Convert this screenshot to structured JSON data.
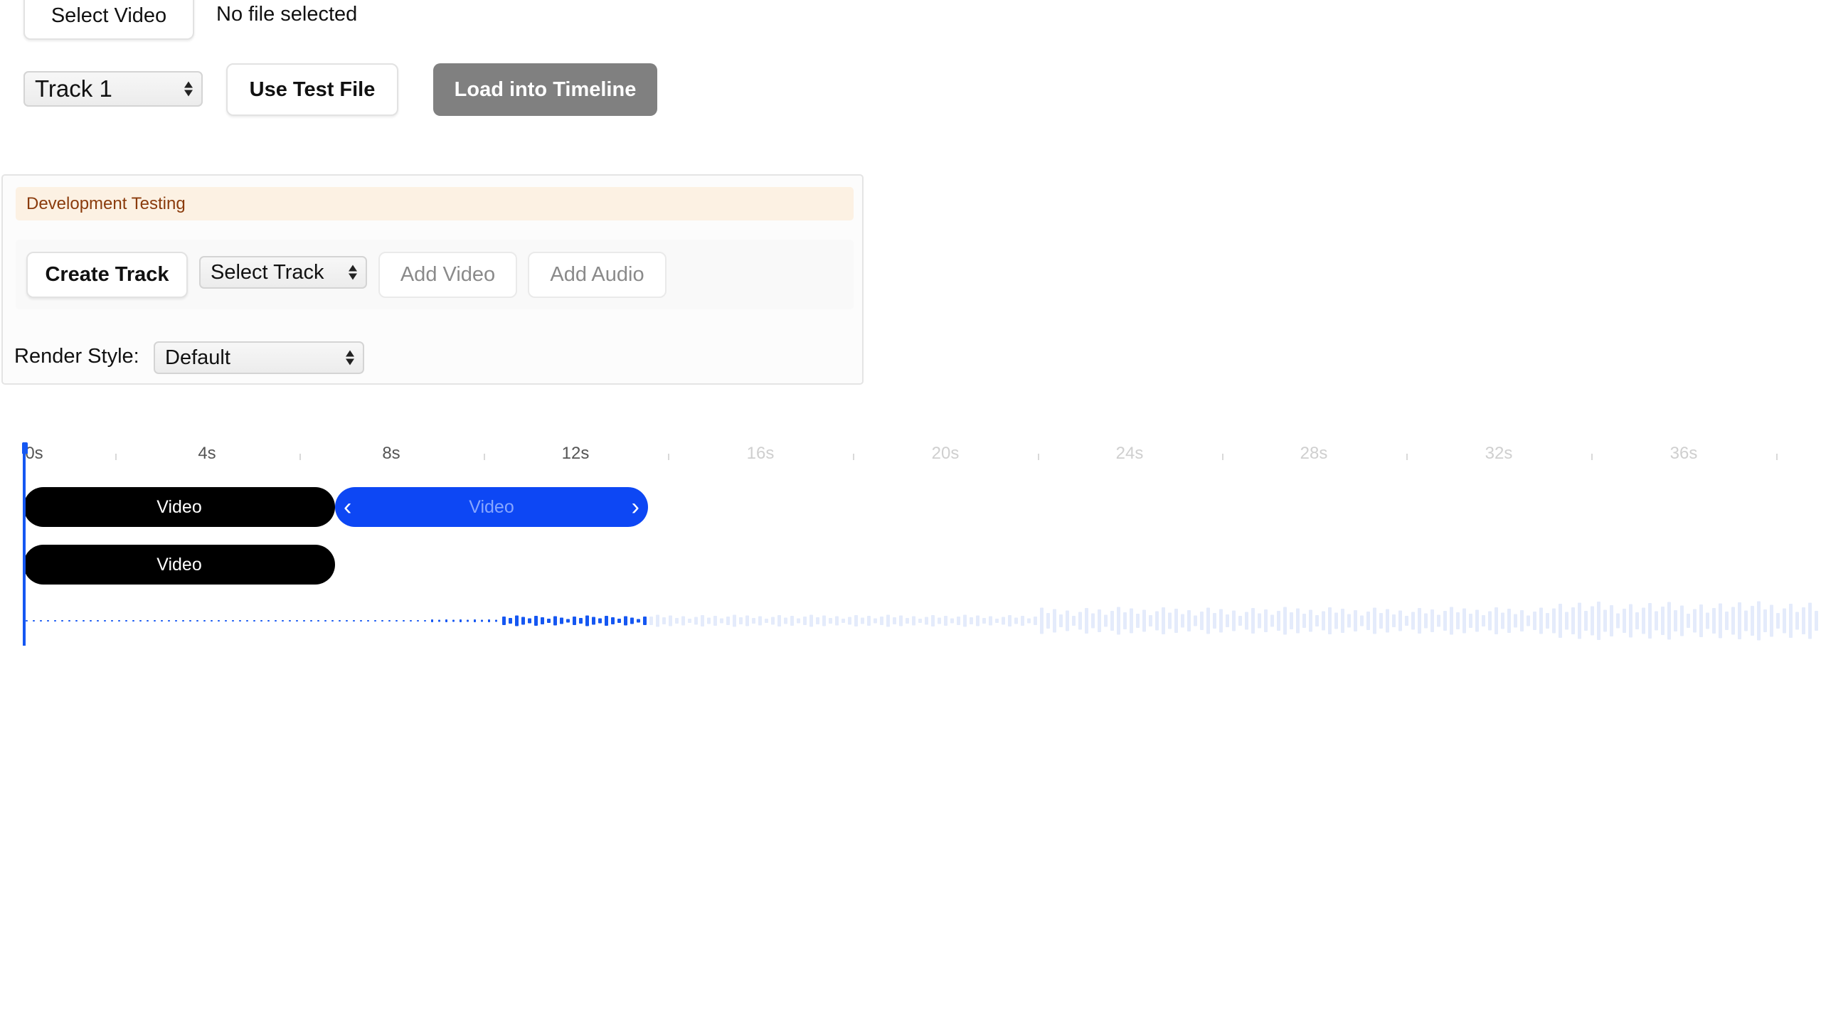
{
  "file_picker": {
    "select_video_label": "Select Video",
    "status_text": "No file selected"
  },
  "controls": {
    "track_select_value": "Track 1",
    "use_test_file_label": "Use Test File",
    "load_label": "Load into Timeline"
  },
  "dev_panel": {
    "title": "Development Testing",
    "create_track_label": "Create Track",
    "select_track_value": "Select Track",
    "add_video_label": "Add Video",
    "add_audio_label": "Add Audio",
    "render_style_label": "Render Style:",
    "render_style_value": "Default"
  },
  "timeline": {
    "ticks": [
      "0s",
      "4s",
      "8s",
      "12s",
      "16s",
      "20s",
      "24s",
      "28s",
      "32s",
      "36s"
    ],
    "tracks": [
      {
        "clips": [
          {
            "label": "Video",
            "start_s": 0,
            "end_s": 6.75,
            "selected": false
          },
          {
            "label": "Video",
            "start_s": 6.75,
            "end_s": 13.5,
            "selected": true
          }
        ]
      },
      {
        "clips": [
          {
            "label": "Video",
            "start_s": 0,
            "end_s": 6.75,
            "selected": false
          }
        ]
      }
    ],
    "playhead_s": 0,
    "colors": {
      "accent": "#0d47f4",
      "clip_dark": "#000000",
      "waveform_active": "#1557f2",
      "waveform_inactive": "#e4ebfb"
    }
  }
}
